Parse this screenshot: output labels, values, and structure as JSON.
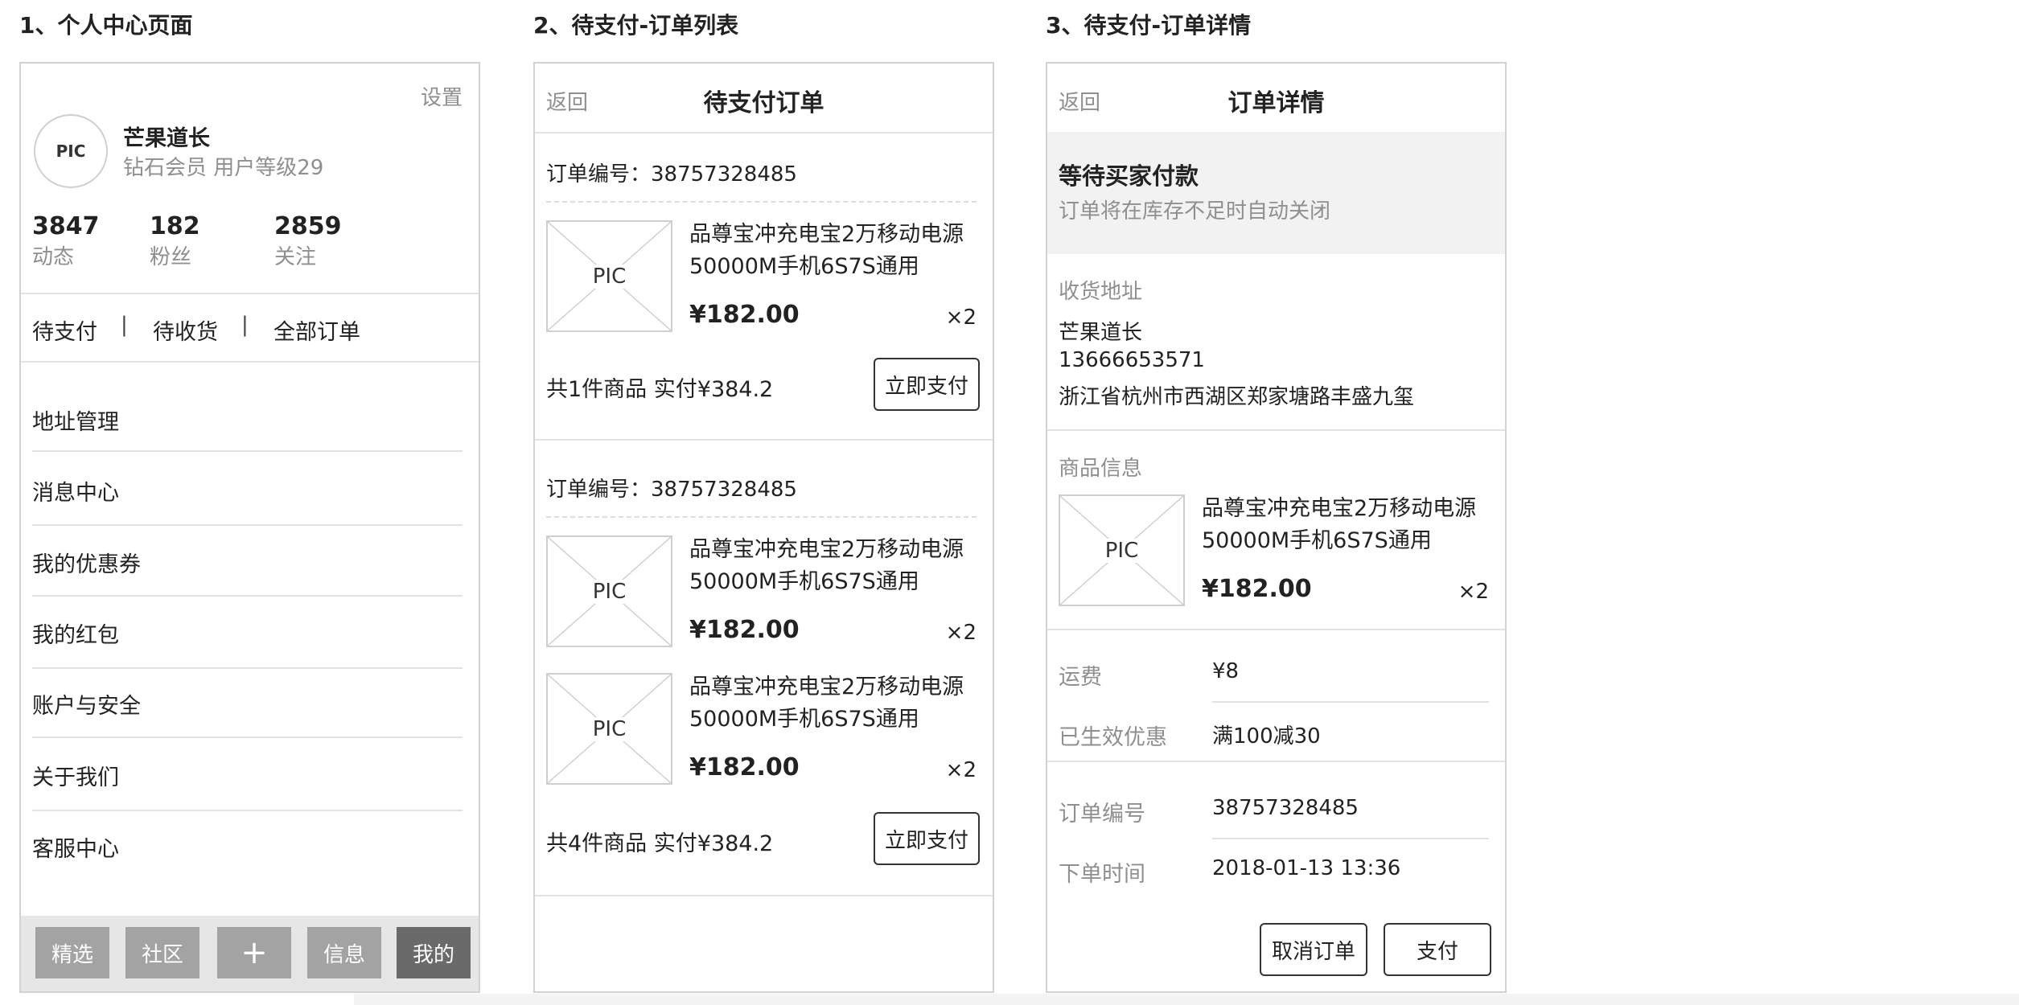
{
  "section1": {
    "title": "1、个人中心页面",
    "settings": "设置",
    "avatar": "PIC",
    "user_name": "芒果道长",
    "member_line": "钻石会员  用户等级29",
    "stats": [
      {
        "value": "3847",
        "label": "动态"
      },
      {
        "value": "182",
        "label": "粉丝"
      },
      {
        "value": "2859",
        "label": "关注"
      }
    ],
    "order_links": [
      "待支付",
      "待收货",
      "全部订单"
    ],
    "separator": "|",
    "menu": [
      "地址管理",
      "消息中心",
      "我的优惠券",
      "我的红包",
      "账户与安全",
      "关于我们",
      "客服中心"
    ],
    "tabs": [
      "精选",
      "社区",
      "+",
      "信息",
      "我的"
    ],
    "active_tab": "我的"
  },
  "section2": {
    "title": "2、待支付-订单列表",
    "back": "返回",
    "nav_title": "待支付订单",
    "orders": [
      {
        "order_no": "订单编号：38757328485",
        "items": [
          {
            "pic": "PIC",
            "name_line1": "品尊宝冲充电宝2万移动电源",
            "name_line2": "50000M手机6S7S通用",
            "price": "¥182.00",
            "qty": "×2"
          }
        ],
        "summary": "共1件商品 实付¥384.2",
        "pay_button": "立即支付"
      },
      {
        "order_no": "订单编号：38757328485",
        "items": [
          {
            "pic": "PIC",
            "name_line1": "品尊宝冲充电宝2万移动电源",
            "name_line2": "50000M手机6S7S通用",
            "price": "¥182.00",
            "qty": "×2"
          },
          {
            "pic": "PIC",
            "name_line1": "品尊宝冲充电宝2万移动电源",
            "name_line2": "50000M手机6S7S通用",
            "price": "¥182.00",
            "qty": "×2"
          }
        ],
        "summary": "共4件商品 实付¥384.2",
        "pay_button": "立即支付"
      }
    ]
  },
  "section3": {
    "title": "3、待支付-订单详情",
    "back": "返回",
    "nav_title": "订单详情",
    "status_title": "等待买家付款",
    "status_note": "订单将在库存不足时自动关闭",
    "address_label": "收货地址",
    "receiver": "芒果道长",
    "phone": "13666653571",
    "address": "浙江省杭州市西湖区郑家塘路丰盛九玺",
    "goods_label": "商品信息",
    "item": {
      "pic": "PIC",
      "name_line1": "品尊宝冲充电宝2万移动电源",
      "name_line2": "50000M手机6S7S通用",
      "price": "¥182.00",
      "qty": "×2"
    },
    "shipping_label": "运费",
    "shipping_value": "¥8",
    "discount_label": "已生效优惠",
    "discount_value": "满100减30",
    "order_no_label": "订单编号",
    "order_no_value": "38757328485",
    "order_time_label": "下单时间",
    "order_time_value": "2018-01-13 13:36",
    "cancel_button": "取消订单",
    "pay_button": "支付"
  }
}
